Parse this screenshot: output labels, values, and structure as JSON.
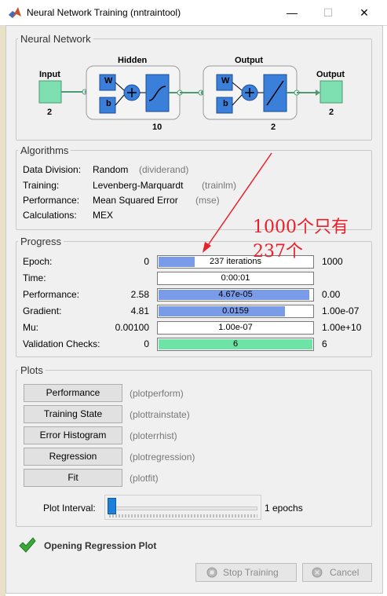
{
  "window": {
    "title": "Neural Network Training (nntraintool)"
  },
  "network": {
    "section_title": "Neural Network",
    "input_label": "Input",
    "input_size": "2",
    "hidden_label": "Hidden",
    "hidden_size": "10",
    "output_layer_label": "Output",
    "output_layer_size": "2",
    "output_label": "Output",
    "output_size": "2",
    "w": "W",
    "b": "b"
  },
  "algorithms": {
    "section_title": "Algorithms",
    "rows": [
      {
        "label": "Data Division:",
        "value": "Random",
        "fn": "(dividerand)"
      },
      {
        "label": "Training:",
        "value": "Levenberg-Marquardt",
        "fn": "(trainlm)"
      },
      {
        "label": "Performance:",
        "value": "Mean Squared Error",
        "fn": "(mse)"
      },
      {
        "label": "Calculations:",
        "value": "MEX",
        "fn": ""
      }
    ]
  },
  "progress": {
    "section_title": "Progress",
    "rows": [
      {
        "label": "Epoch:",
        "start": "0",
        "value": "237 iterations",
        "end": "1000",
        "fill": 0.237
      },
      {
        "label": "Time:",
        "start": "",
        "value": "0:00:01",
        "end": "",
        "fill": 0
      },
      {
        "label": "Performance:",
        "start": "2.58",
        "value": "4.67e-05",
        "end": "0.00",
        "fill": 0.98
      },
      {
        "label": "Gradient:",
        "start": "4.81",
        "value": "0.0159",
        "end": "1.00e-07",
        "fill": 0.82
      },
      {
        "label": "Mu:",
        "start": "0.00100",
        "value": "1.00e-07",
        "end": "1.00e+10",
        "fill": 0
      },
      {
        "label": "Validation Checks:",
        "start": "0",
        "value": "6",
        "end": "6",
        "fill": 1.0
      }
    ]
  },
  "plots": {
    "section_title": "Plots",
    "buttons": [
      {
        "label": "Performance",
        "fn": "(plotperform)"
      },
      {
        "label": "Training State",
        "fn": "(plottrainstate)"
      },
      {
        "label": "Error Histogram",
        "fn": "(ploterrhist)"
      },
      {
        "label": "Regression",
        "fn": "(plotregression)"
      },
      {
        "label": "Fit",
        "fn": "(plotfit)"
      }
    ],
    "interval_label": "Plot Interval:",
    "interval_value": "1 epochs",
    "interval_fraction": 0
  },
  "status": {
    "text": "Opening Regression Plot"
  },
  "actions": {
    "stop": "Stop Training",
    "cancel": "Cancel"
  },
  "annotation": {
    "line1": "1000个只有",
    "line2": "237个"
  },
  "colors": {
    "accent_fill": "#7a9be8",
    "validation_fill": "#6ee3a6",
    "annotation": "#e8202a",
    "check": "#3aa83a"
  }
}
